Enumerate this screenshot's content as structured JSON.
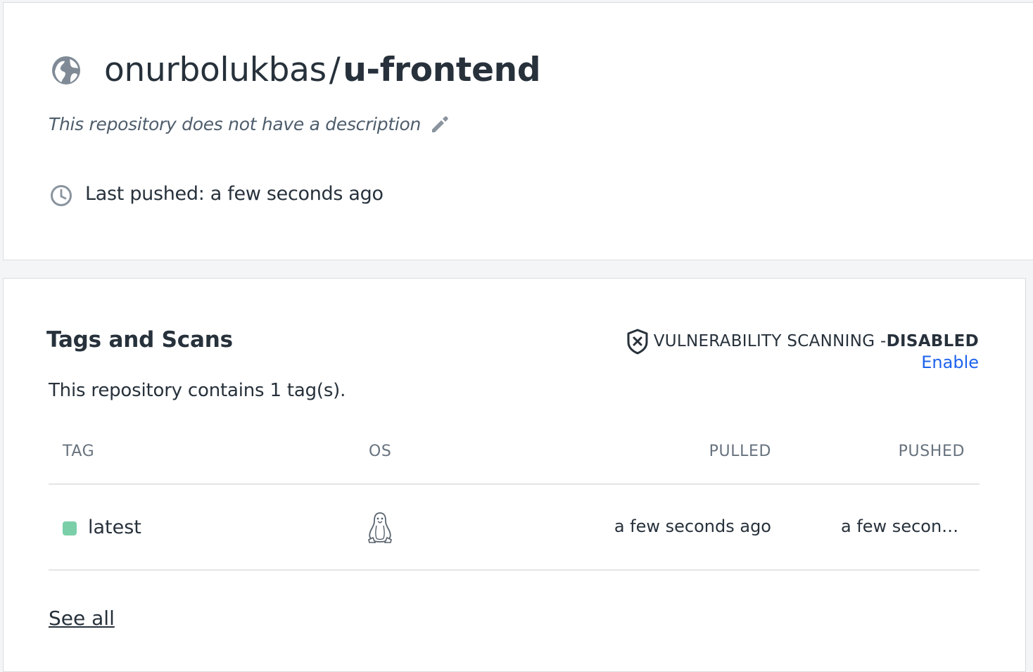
{
  "repository": {
    "owner": "onurbolukbas",
    "separator": "/",
    "name": "u-frontend",
    "description": "This repository does not have a description",
    "last_pushed": "Last pushed: a few seconds ago",
    "visibility_icon": "globe-icon"
  },
  "tags_section": {
    "title": "Tags and Scans",
    "vulnerability_label": "VULNERABILITY SCANNING - ",
    "vulnerability_status": "DISABLED",
    "enable_link": "Enable",
    "tag_count_text": "This repository contains 1 tag(s).",
    "columns": {
      "tag": "TAG",
      "os": "OS",
      "pulled": "PULLED",
      "pushed": "PUSHED"
    },
    "rows": [
      {
        "tag": "latest",
        "os_icon": "linux-penguin-icon",
        "pulled": "a few seconds ago",
        "pushed": "a few seconds ago",
        "status_color": "#7acfa8"
      }
    ],
    "see_all": "See all"
  },
  "colors": {
    "accent_link": "#1d63ed",
    "text": "#27313b",
    "muted": "#67727e"
  }
}
